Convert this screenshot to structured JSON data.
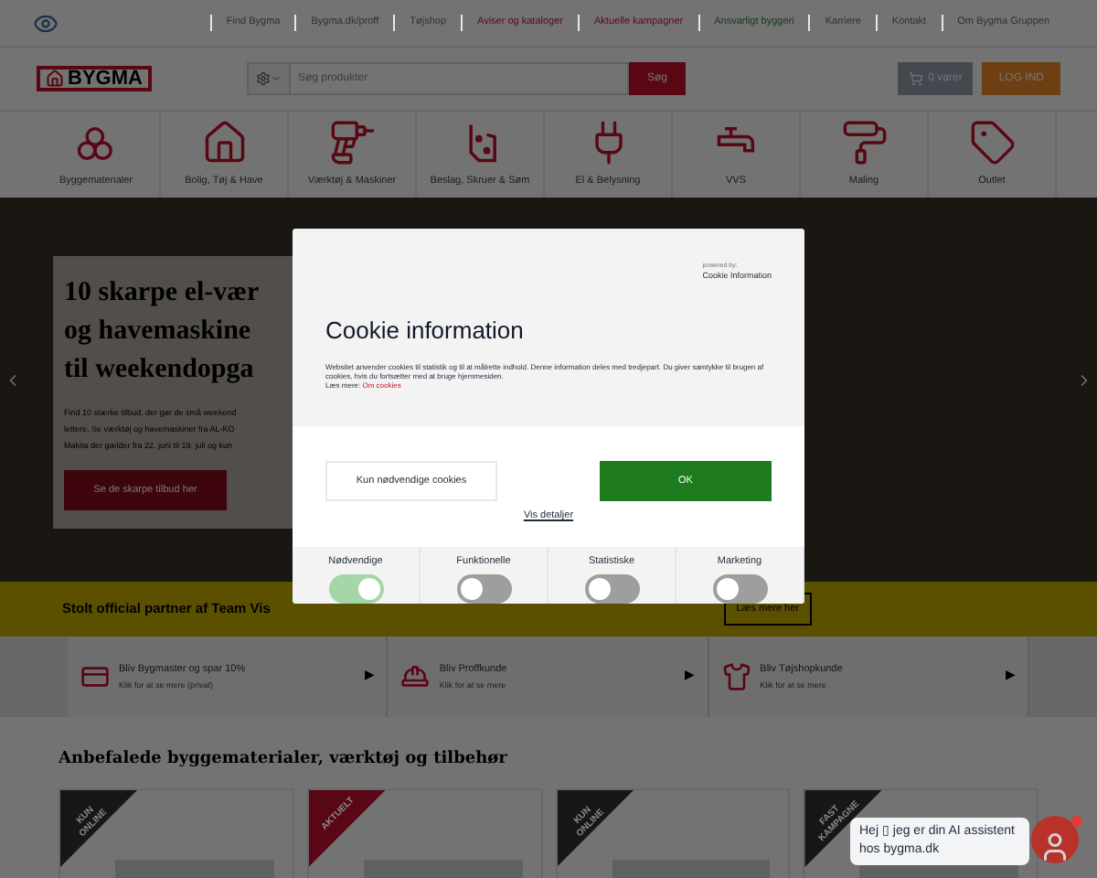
{
  "top_links": [
    {
      "label": "Find Bygma",
      "color": "#303030"
    },
    {
      "label": "Bygma.dk/proff",
      "color": "#303030"
    },
    {
      "label": "Tøjshop",
      "color": "#303030"
    },
    {
      "label": "Aviser og kataloger",
      "color": "#5a0715"
    },
    {
      "label": "Aktuelle kampagner",
      "color": "#5a0715"
    },
    {
      "label": "Ansvarligt byggeri",
      "color": "#153817"
    },
    {
      "label": "Karriere",
      "color": "#303030"
    },
    {
      "label": "Kontakt",
      "color": "#303030"
    },
    {
      "label": "Om Bygma Gruppen",
      "color": "#303030"
    }
  ],
  "logo": "BYGMA",
  "search": {
    "placeholder": "Søg produkter",
    "button": "Søg"
  },
  "cart": "0 varer",
  "login": "LOG IND",
  "categories": [
    {
      "label": "Byggematerialer",
      "kind": "logs"
    },
    {
      "label": "Bolig, Tøj & Have",
      "kind": "house"
    },
    {
      "label": "Værktøj & Maskiner",
      "kind": "drill"
    },
    {
      "label": "Beslag, Skruer & Søm",
      "kind": "bracket"
    },
    {
      "label": "El & Belysning",
      "kind": "plug"
    },
    {
      "label": "VVS",
      "kind": "tap"
    },
    {
      "label": "Maling",
      "kind": "roller"
    },
    {
      "label": "Outlet",
      "kind": "tag"
    }
  ],
  "hero": {
    "title_lines": [
      "10 skarpe el-vær",
      "og havemaskine",
      "til weekendopga"
    ],
    "text_lines": [
      "Find 10 stærke tilbud, der gør de små weekend",
      "lettere. Se værktøj og havemaskiner fra AL-KO",
      "Makita der gælder fra 22. juni til 19. juli og kun"
    ],
    "button": "Se de skarpe tilbud her"
  },
  "partner": {
    "text": "Stolt official partner af Team Vis",
    "button": "Læs mere her"
  },
  "benefits": [
    {
      "kind": "card",
      "title": "Bliv Bygmaster og spar 10%",
      "subtitle": "Klik for at se mere (privat)",
      "arrow": "▶"
    },
    {
      "kind": "helmet",
      "title": "Bliv Proffkunde",
      "subtitle": "Klik for at se mere",
      "arrow": "▶"
    },
    {
      "kind": "shirt",
      "title": "Bliv Tøjshopkunde",
      "subtitle": "Klik for at se mere",
      "arrow": "▶"
    }
  ],
  "products_heading": "Anbefalede byggematerialer, værktøj og tilbehør",
  "products": [
    {
      "ribbon": "KUN ONLINE",
      "color": "#171717"
    },
    {
      "ribbon": "AKTUELT",
      "color": "#5a0715"
    },
    {
      "ribbon": "KUN ONLINE",
      "color": "#171717"
    },
    {
      "ribbon": "FAST KAMPAGNE",
      "color": "#171717"
    }
  ],
  "chat": {
    "message": "Hej ▯ jeg er din AI assistent hos bygma.dk"
  },
  "cookie_dialog": {
    "powered_by": "powered by:",
    "provider": "Cookie Information",
    "title": "Cookie information",
    "body": "Websitet anvender cookies til statistik og til at målrette indhold. Denne information deles med tredjepart. Du giver samtykke til brugen af cookies, hvis du fortsætter med at bruge hjemmesiden.",
    "read_more": "Læs mere:",
    "read_more_link": "Om cookies",
    "necessary_button": "Kun nødvendige cookies",
    "ok_button": "OK",
    "details_link": "Vis detaljer",
    "categories": [
      {
        "label": "Nødvendige",
        "on": true,
        "disabled": true
      },
      {
        "label": "Funktionelle",
        "on": false,
        "disabled": false
      },
      {
        "label": "Statistiske",
        "on": false,
        "disabled": false
      },
      {
        "label": "Marketing",
        "on": false,
        "disabled": false
      }
    ]
  }
}
